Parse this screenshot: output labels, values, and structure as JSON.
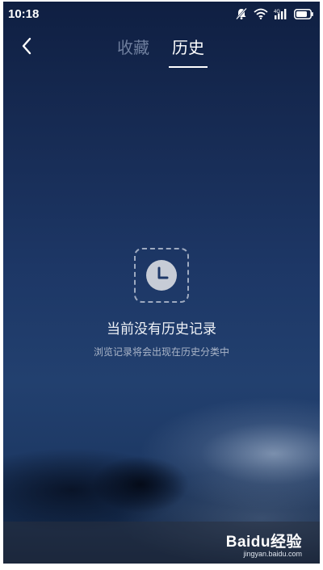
{
  "status_bar": {
    "time": "10:18",
    "icons": [
      "mute-bell-icon",
      "wifi-icon",
      "signal-icon",
      "battery-icon"
    ]
  },
  "nav": {
    "back_icon": "chevron-left-icon",
    "tabs": [
      {
        "label": "收藏",
        "active": false
      },
      {
        "label": "历史",
        "active": true
      }
    ]
  },
  "empty_state": {
    "icon": "clock-icon",
    "title": "当前没有历史记录",
    "subtitle": "浏览记录将会出现在历史分类中"
  },
  "watermark": {
    "logo": "Baidu经验",
    "url": "jingyan.baidu.com"
  },
  "colors": {
    "background_top": "#0f1f42",
    "background_mid": "#22406f",
    "inactive_tab": "#6f7f9e",
    "text_primary": "#ffffff"
  }
}
